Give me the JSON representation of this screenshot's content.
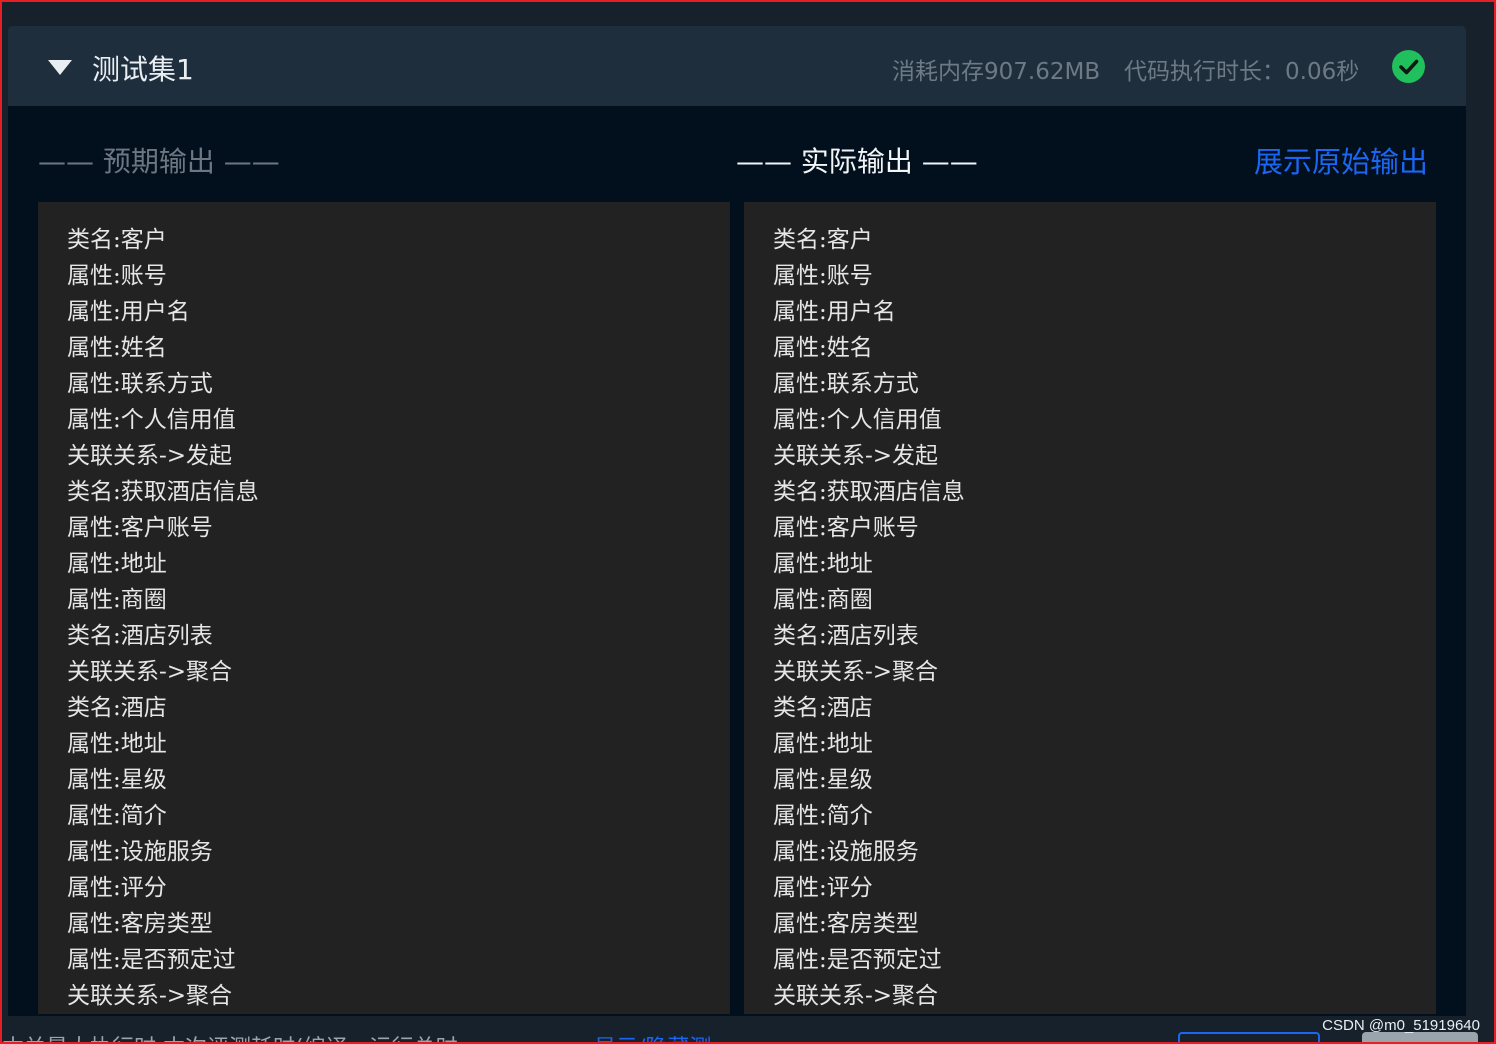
{
  "header": {
    "title": "测试集1",
    "memory": "消耗内存907.62MB",
    "exec_time": "代码执行时长：0.06秒",
    "status_icon": "check-circle-icon",
    "status_color": "#20c05c"
  },
  "output": {
    "expected_heading": "—— 预期输出 ——",
    "actual_heading": "—— 实际输出 ——",
    "show_raw_label": "展示原始输出",
    "expected_lines": [
      "类名:客户",
      "属性:账号",
      "属性:用户名",
      "属性:姓名",
      "属性:联系方式",
      "属性:个人信用值",
      "关联关系->发起",
      "类名:获取酒店信息",
      "属性:客户账号",
      "属性:地址",
      "属性:商圈",
      "类名:酒店列表",
      "关联关系->聚合",
      "类名:酒店",
      "属性:地址",
      "属性:星级",
      "属性:简介",
      "属性:设施服务",
      "属性:评分",
      "属性:客房类型",
      "属性:是否预定过",
      "关联关系->聚合"
    ],
    "actual_lines": [
      "类名:客户",
      "属性:账号",
      "属性:用户名",
      "属性:姓名",
      "属性:联系方式",
      "属性:个人信用值",
      "关联关系->发起",
      "类名:获取酒店信息",
      "属性:客户账号",
      "属性:地址",
      "属性:商圈",
      "类名:酒店列表",
      "关联关系->聚合",
      "类名:酒店",
      "属性:地址",
      "属性:星级",
      "属性:简介",
      "属性:设施服务",
      "属性:评分",
      "属性:客房类型",
      "属性:是否预定过",
      "关联关系->聚合"
    ]
  },
  "footer": {
    "left_text": "本关最大执行时     本次评测耗时(编译、运行总时",
    "link_text": "显示/隐藏测"
  },
  "watermark": "CSDN @m0_51919640"
}
